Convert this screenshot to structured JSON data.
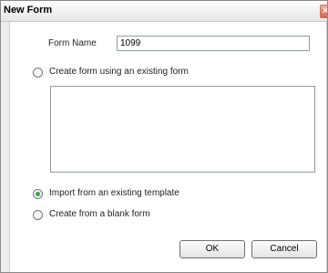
{
  "window": {
    "title": "New Form",
    "close_glyph": "×"
  },
  "form": {
    "name_label": "Form Name",
    "name_value": "1099"
  },
  "options": {
    "existing_form_label": "Create form using an existing form",
    "existing_form_selected": false,
    "template_label": "Import from an existing template",
    "template_selected": true,
    "blank_label": "Create from a blank form",
    "blank_selected": false
  },
  "buttons": {
    "ok_label": "OK",
    "cancel_label": "Cancel"
  },
  "colors": {
    "radio_selected": "#3aa53a",
    "window_background": "#ececec"
  }
}
